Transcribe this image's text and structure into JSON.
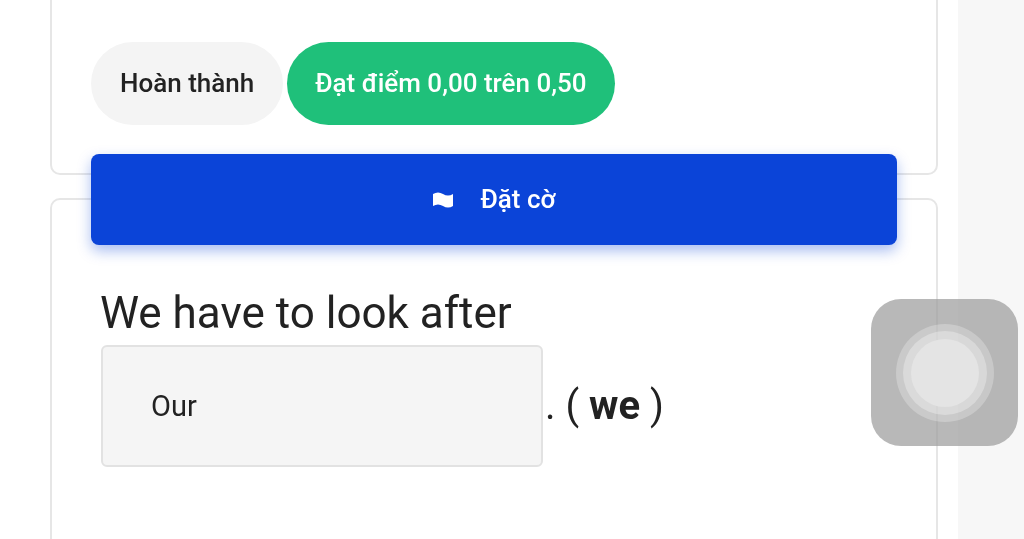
{
  "status_pills": [
    {
      "label": "Hoàn thành",
      "kind": "neutral"
    },
    {
      "label": "Đạt điểm 0,00 trên 0,50",
      "kind": "score"
    }
  ],
  "flag_button": {
    "label": "Đặt cờ"
  },
  "question": {
    "prompt": "We have to look after",
    "answer": {
      "value": "Our"
    },
    "suffix": ". ( **we** )"
  }
}
